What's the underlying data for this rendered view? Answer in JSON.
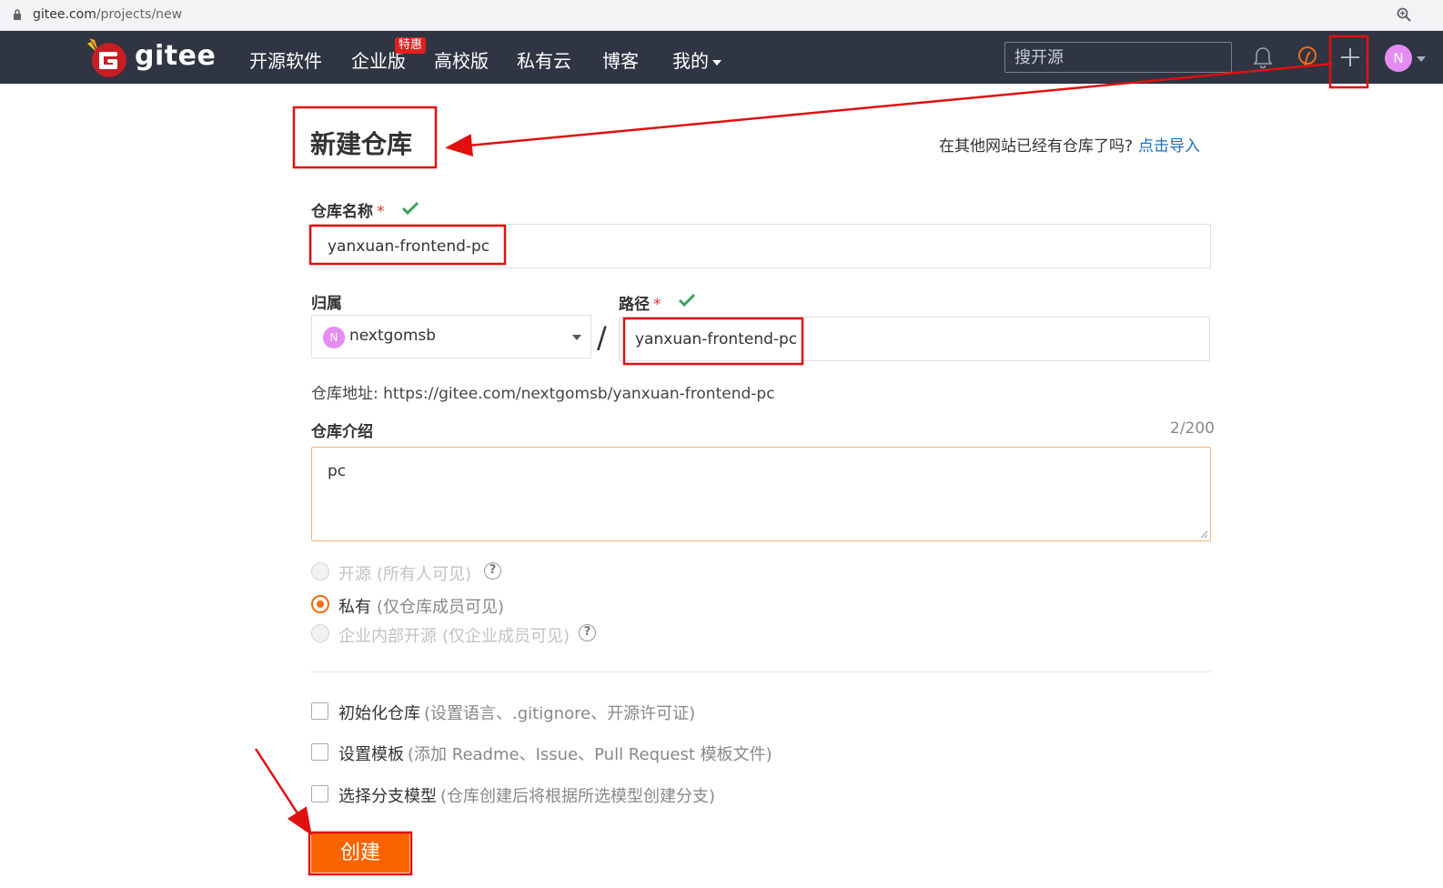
{
  "browser": {
    "url_host": "gitee.com",
    "url_path": "/projects/new"
  },
  "nav": {
    "logo_text": "gitee",
    "links": [
      "开源软件",
      "企业版",
      "高校版",
      "私有云",
      "博客",
      "我的"
    ],
    "badge": "特惠",
    "search_placeholder": "搜开源",
    "avatar_letter": "N"
  },
  "page": {
    "title": "新建仓库",
    "import_question": "在其他网站已经有仓库了吗?",
    "import_link": "点击导入"
  },
  "form": {
    "name_label": "仓库名称",
    "required_mark": "*",
    "name_value": "yanxuan-frontend-pc",
    "owner_label": "归属",
    "owner_avatar": "N",
    "owner_value": "nextgomsb",
    "separator": "/",
    "path_label": "路径",
    "path_value": "yanxuan-frontend-pc",
    "repo_url_text": "仓库地址: https://gitee.com/nextgomsb/yanxuan-frontend-pc",
    "desc_label": "仓库介绍",
    "desc_counter": "2/200",
    "desc_value": "pc"
  },
  "visibility": [
    {
      "label": "开源",
      "hint": "(所有人可见)",
      "selected": false,
      "disabled": true
    },
    {
      "label": "私有",
      "hint": "(仅仓库成员可见)",
      "selected": true,
      "disabled": false
    },
    {
      "label": "企业内部开源",
      "hint": "(仅企业成员可见)",
      "selected": false,
      "disabled": true
    }
  ],
  "help_glyph": "?",
  "options": [
    {
      "label": "初始化仓库",
      "hint": "(设置语言、.gitignore、开源许可证)"
    },
    {
      "label": "设置模板",
      "hint": "(添加 Readme、Issue、Pull Request 模板文件)"
    },
    {
      "label": "选择分支模型",
      "hint": "(仓库创建后将根据所选模型创建分支)"
    }
  ],
  "submit_label": "创建",
  "colors": {
    "nav_bg": "#2f3542",
    "accent": "#fa6400",
    "link": "#1e6fbf",
    "annotation_red": "#e01010",
    "check_green": "#3aa35a"
  }
}
